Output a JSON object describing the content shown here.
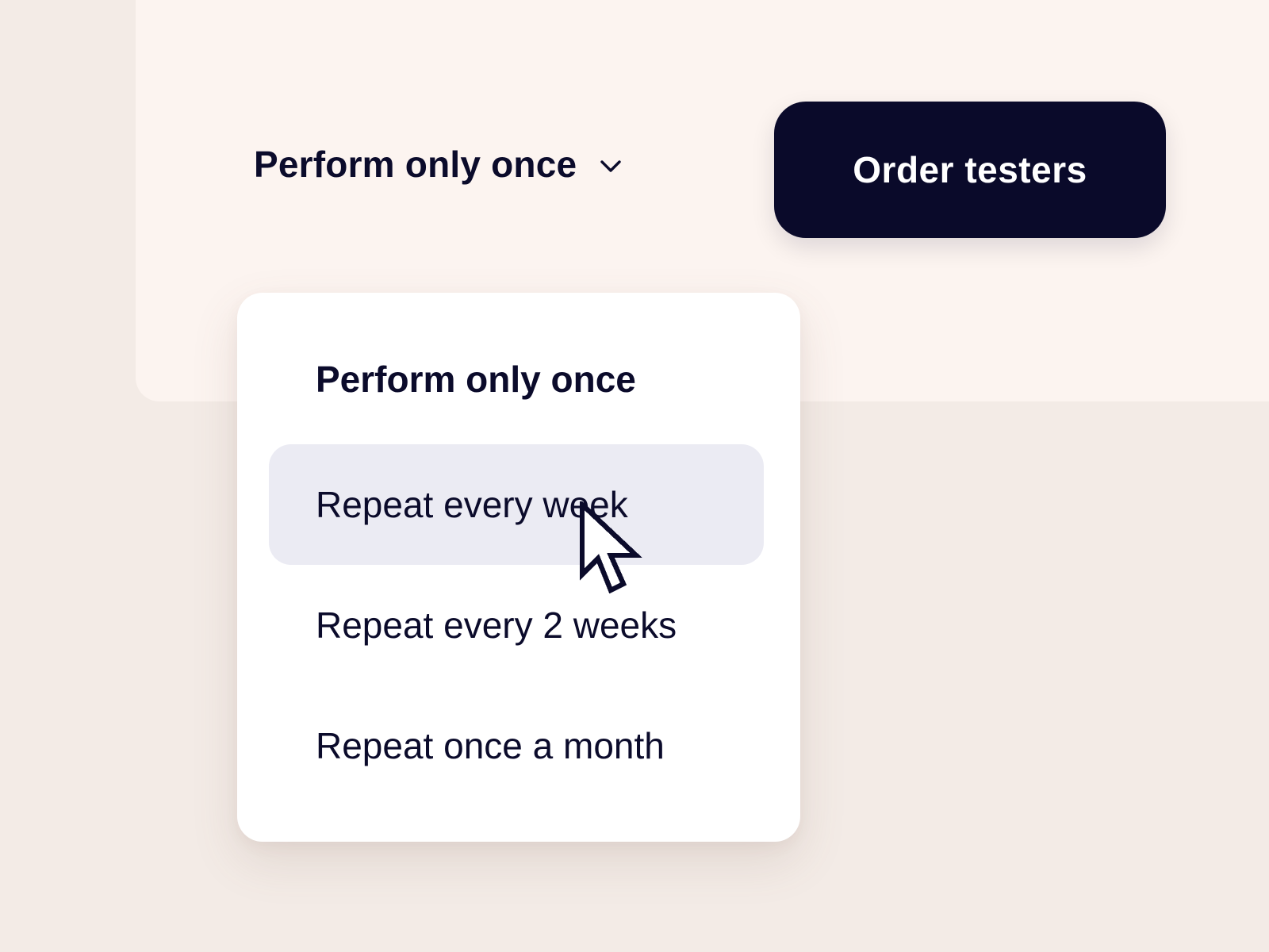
{
  "frequency_select": {
    "selected_label": "Perform only once",
    "chevron_icon": "chevron-down-icon"
  },
  "order_button": {
    "label": "Order testers"
  },
  "dropdown": {
    "options": [
      {
        "label": "Perform only once"
      },
      {
        "label": "Repeat every week"
      },
      {
        "label": "Repeat every 2 weeks"
      },
      {
        "label": "Repeat once a month"
      }
    ]
  },
  "colors": {
    "page_background": "#f3ebe6",
    "card_background": "#fcf4f0",
    "primary_dark": "#0a0a2a",
    "hover_background": "#ebebf3",
    "menu_background": "#ffffff"
  },
  "cursor_icon": "pointer-arrow-cursor-icon"
}
